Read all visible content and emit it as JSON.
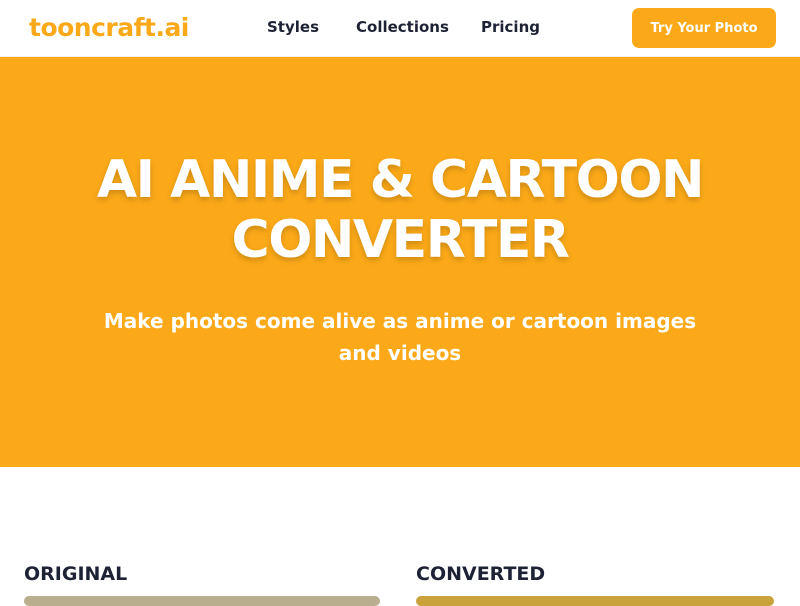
{
  "header": {
    "logo": "tooncraft.ai",
    "nav": [
      {
        "label": "Styles"
      },
      {
        "label": "Collections"
      },
      {
        "label": "Pricing"
      }
    ],
    "cta_label": "Try Your Photo"
  },
  "hero": {
    "title_line1": "AI ANIME & CARTOON",
    "title_line2": "CONVERTER",
    "subtitle": "Make photos come alive as anime or cartoon images and videos"
  },
  "comparison": {
    "original_label": "ORIGINAL",
    "converted_label": "CONVERTED"
  },
  "colors": {
    "brand": "#fba919",
    "text_dark": "#1e2235",
    "white": "#ffffff"
  }
}
